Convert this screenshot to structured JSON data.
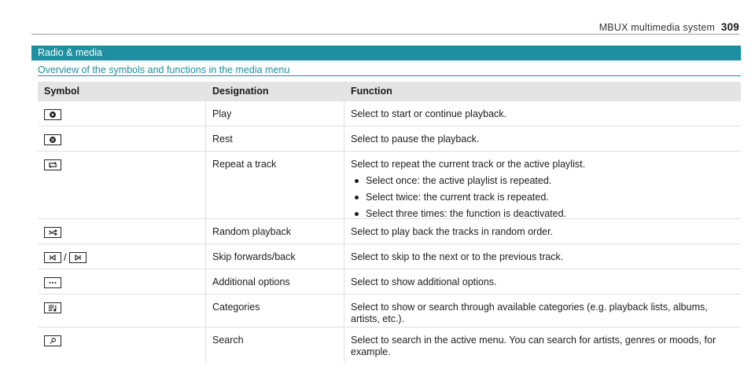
{
  "header": {
    "chapter": "MBUX multimedia system",
    "page_number": "309"
  },
  "section": {
    "title": "Radio & media"
  },
  "subtitle": "Overview of the symbols and functions in the media menu",
  "table": {
    "headers": {
      "symbol": "Symbol",
      "designation": "Designation",
      "function": "Function"
    },
    "rows": [
      {
        "icon": "play-icon",
        "designation": "Play",
        "function": "Select to start or continue playback."
      },
      {
        "icon": "pause-icon",
        "designation": "Rest",
        "function": "Select to pause the playback."
      },
      {
        "icon": "repeat-icon",
        "designation": "Repeat a track",
        "function": "Select to repeat the current track or the active playlist.",
        "bullets": [
          "Select once: the active playlist is repeated.",
          "Select twice: the current track is repeated.",
          "Select three times: the function is deactivated."
        ]
      },
      {
        "icon": "shuffle-icon",
        "designation": "Random playback",
        "function": "Select to play back the tracks in random order."
      },
      {
        "icon": "skip-back-icon / skip-forward-icon",
        "separator": "/",
        "designation": "Skip forwards/back",
        "function": "Select to skip to the next or to the previous track."
      },
      {
        "icon": "more-options-icon",
        "designation": "Additional options",
        "function": "Select to show additional options."
      },
      {
        "icon": "categories-icon",
        "designation": "Categories",
        "function": "Select to show or search through available categories (e.g. playback lists, albums, artists, etc.)."
      },
      {
        "icon": "search-icon",
        "designation": "Search",
        "function": "Select to search in the active menu. You can search for artists, genres or moods, for example."
      }
    ]
  },
  "colors": {
    "accent": "#1c8fa0",
    "header_bg": "#e4e4e4"
  }
}
